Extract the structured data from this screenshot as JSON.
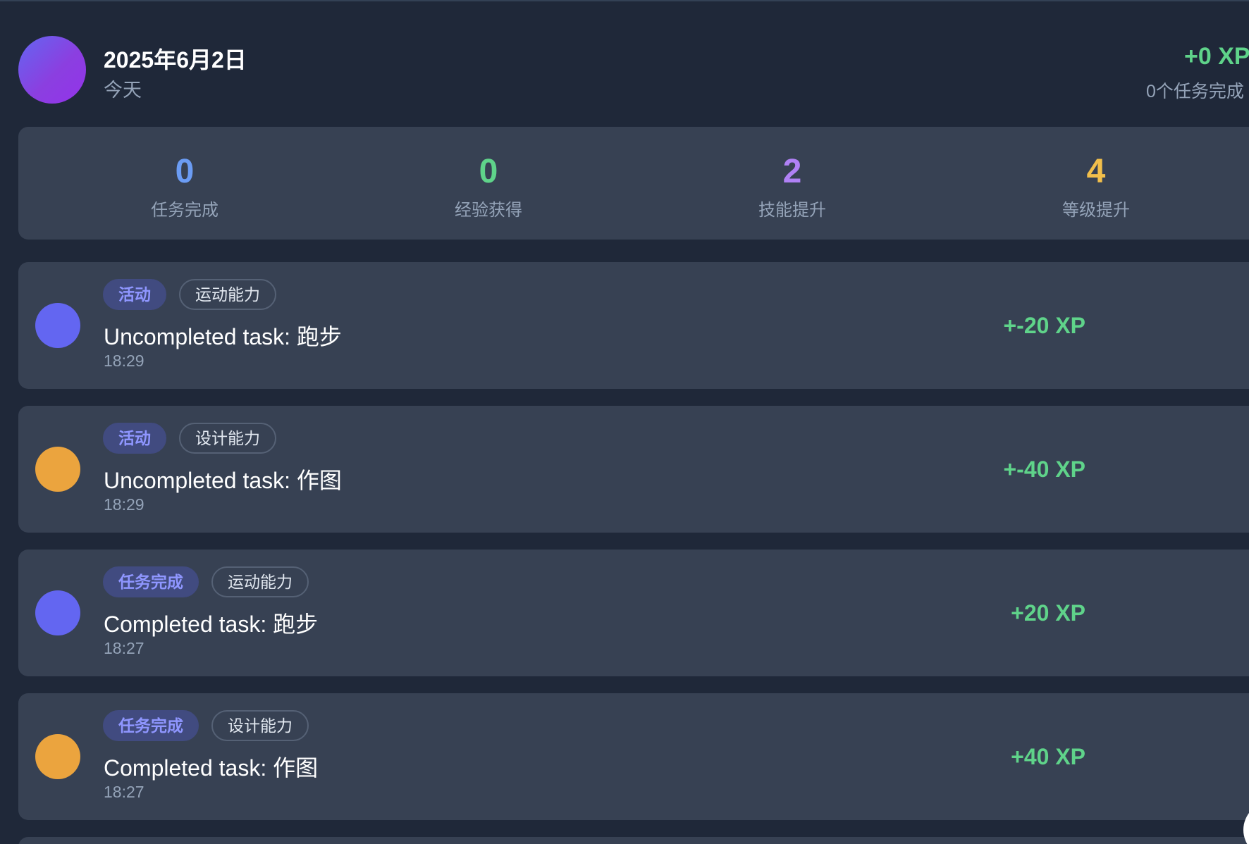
{
  "header": {
    "date": "2025年6月2日",
    "subtitle": "今天",
    "xp_total": "+0 XP",
    "tasks_done": "0个任务完成"
  },
  "stats": [
    {
      "value": "0",
      "label": "任务完成",
      "color": "#6b9cf4"
    },
    {
      "value": "0",
      "label": "经验获得",
      "color": "#5fd38a"
    },
    {
      "value": "2",
      "label": "技能提升",
      "color": "#b081f5"
    },
    {
      "value": "4",
      "label": "等级提升",
      "color": "#f2bf4b"
    }
  ],
  "activities": [
    {
      "type": "活动",
      "skill": "运动能力",
      "title": "Uncompleted task: 跑步",
      "time": "18:29",
      "xp": "+-20 XP",
      "dot_color": "#6366f1"
    },
    {
      "type": "活动",
      "skill": "设计能力",
      "title": "Uncompleted task: 作图",
      "time": "18:29",
      "xp": "+-40 XP",
      "dot_color": "#eba43e"
    },
    {
      "type": "任务完成",
      "skill": "运动能力",
      "title": "Completed task: 跑步",
      "time": "18:27",
      "xp": "+20 XP",
      "dot_color": "#6366f1"
    },
    {
      "type": "任务完成",
      "skill": "设计能力",
      "title": "Completed task: 作图",
      "time": "18:27",
      "xp": "+40 XP",
      "dot_color": "#eba43e"
    }
  ]
}
